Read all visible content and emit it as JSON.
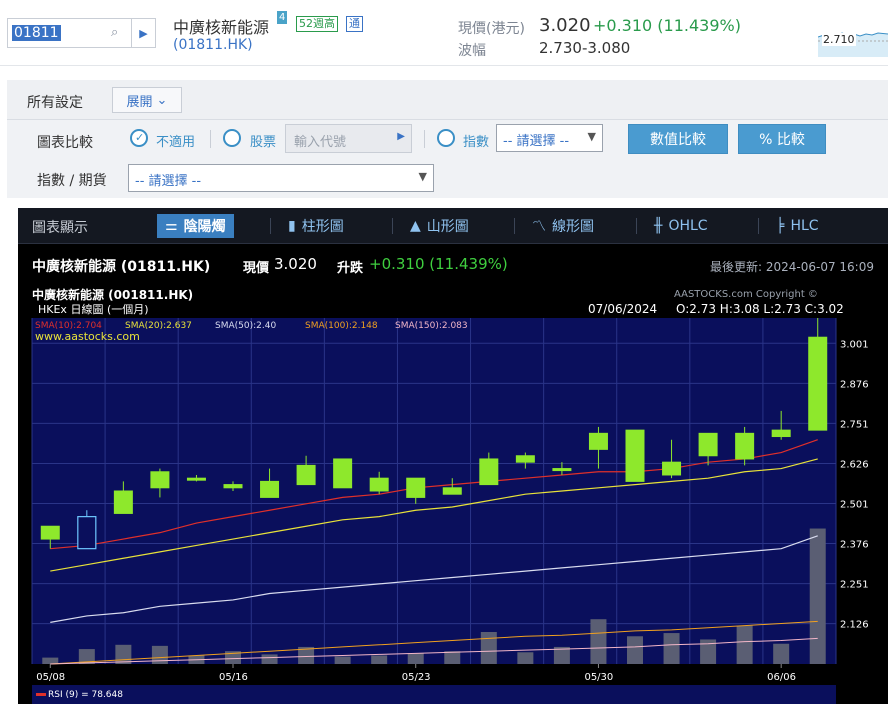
{
  "search": {
    "code": "01811"
  },
  "stock": {
    "name": "中廣核新能源",
    "badge_rank": "4",
    "badge_52w": "52週高",
    "badge_connect": "通",
    "code": "(01811.HK)",
    "price_label": "現價(港元)",
    "price": "3.020",
    "change": "+0.310 (11.439%)",
    "range_label": "波幅",
    "range": "2.730-3.080",
    "mini_label": "2.710"
  },
  "settings": {
    "title": "所有設定",
    "expand": "展開",
    "compare_label": "圖表比較",
    "opt_none": "不適用",
    "opt_stock": "股票",
    "code_placeholder": "輸入代號",
    "opt_index": "指數",
    "select_placeholder": "-- 請選擇 --",
    "btn_value": "數值比較",
    "btn_percent": "% 比較",
    "index_label": "指數 / 期貨",
    "index_select": "-- 請選擇 --"
  },
  "chart_tabs": {
    "title": "圖表顯示",
    "candle": "陰陽燭",
    "bar": "柱形圖",
    "mountain": "山形圖",
    "line": "線形圖",
    "ohlc": "OHLC",
    "hlc": "HLC"
  },
  "chart_info": {
    "name": "中廣核新能源 (01811.HK)",
    "price_label": "現價",
    "price": "3.020",
    "change_label": "升跌",
    "change": "+0.310 (11.439%)",
    "last_update": "最後更新: 2024-06-07 16:09"
  },
  "colors": {
    "up": "#8ee82c",
    "down": "#6ec7ff",
    "plot_bg": "#0a0f5c",
    "sma10": "#e0302a",
    "sma20": "#e8e23a",
    "sma50": "#d9dcef",
    "sma100": "#f0a020",
    "sma150": "#f2b6c8"
  },
  "chart_data": {
    "type": "candlestick",
    "title": "中廣核新能源 (001811.HK)",
    "subtitle": "HKEx 日線圖 (一個月)",
    "copyright": "AASTOCKS.com Copyright ©",
    "watermark": "www.aastocks.com",
    "date_readout": "07/06/2024",
    "ohlc_readout": "O:2.73  H:3.08  L:2.73  C:3.02",
    "sma_labels": {
      "sma10": "SMA(10):2.704",
      "sma20": "SMA(20):2.637",
      "sma50": "SMA(50):2.40",
      "sma100": "SMA(100):2.148",
      "sma150": "SMA(150):2.083"
    },
    "rsi_label": "RSI (9)  = 78.648",
    "y_ticks": [
      "3.001",
      "2.876",
      "2.751",
      "2.626",
      "2.501",
      "2.376",
      "2.251",
      "2.126"
    ],
    "ylim": [
      2.0,
      3.08
    ],
    "x_labels": [
      {
        "label": "05/08",
        "index": 0
      },
      {
        "label": "05/16",
        "index": 5
      },
      {
        "label": "05/23",
        "index": 10
      },
      {
        "label": "05/30",
        "index": 15
      },
      {
        "label": "06/06",
        "index": 20
      }
    ],
    "candles": [
      {
        "o": 2.39,
        "h": 2.42,
        "l": 2.36,
        "c": 2.43
      },
      {
        "o": 2.46,
        "h": 2.48,
        "l": 2.39,
        "c": 2.36
      },
      {
        "o": 2.47,
        "h": 2.57,
        "l": 2.47,
        "c": 2.54
      },
      {
        "o": 2.55,
        "h": 2.61,
        "l": 2.52,
        "c": 2.6
      },
      {
        "o": 2.58,
        "h": 2.59,
        "l": 2.57,
        "c": 2.58
      },
      {
        "o": 2.55,
        "h": 2.57,
        "l": 2.54,
        "c": 2.56
      },
      {
        "o": 2.52,
        "h": 2.61,
        "l": 2.52,
        "c": 2.57
      },
      {
        "o": 2.56,
        "h": 2.65,
        "l": 2.56,
        "c": 2.62
      },
      {
        "o": 2.55,
        "h": 2.64,
        "l": 2.55,
        "c": 2.64
      },
      {
        "o": 2.54,
        "h": 2.6,
        "l": 2.53,
        "c": 2.58
      },
      {
        "o": 2.52,
        "h": 2.58,
        "l": 2.5,
        "c": 2.58
      },
      {
        "o": 2.53,
        "h": 2.58,
        "l": 2.53,
        "c": 2.55
      },
      {
        "o": 2.56,
        "h": 2.66,
        "l": 2.56,
        "c": 2.64
      },
      {
        "o": 2.63,
        "h": 2.66,
        "l": 2.61,
        "c": 2.65
      },
      {
        "o": 2.61,
        "h": 2.63,
        "l": 2.59,
        "c": 2.61
      },
      {
        "o": 2.67,
        "h": 2.74,
        "l": 2.61,
        "c": 2.72
      },
      {
        "o": 2.57,
        "h": 2.73,
        "l": 2.57,
        "c": 2.73
      },
      {
        "o": 2.59,
        "h": 2.7,
        "l": 2.58,
        "c": 2.63
      },
      {
        "o": 2.65,
        "h": 2.72,
        "l": 2.62,
        "c": 2.72
      },
      {
        "o": 2.64,
        "h": 2.74,
        "l": 2.62,
        "c": 2.72
      },
      {
        "o": 2.71,
        "h": 2.79,
        "l": 2.7,
        "c": 2.73
      },
      {
        "o": 2.73,
        "h": 3.08,
        "l": 2.73,
        "c": 3.02
      }
    ],
    "volume": [
      6,
      14,
      18,
      17,
      8,
      12,
      9,
      16,
      7,
      8,
      10,
      12,
      30,
      11,
      16,
      42,
      26,
      29,
      23,
      36,
      19,
      127
    ],
    "volume_max": 150,
    "series": [
      {
        "name": "SMA(10)",
        "values": [
          2.36,
          2.37,
          2.39,
          2.41,
          2.44,
          2.46,
          2.48,
          2.5,
          2.52,
          2.53,
          2.55,
          2.56,
          2.57,
          2.58,
          2.59,
          2.6,
          2.6,
          2.61,
          2.63,
          2.64,
          2.66,
          2.7
        ]
      },
      {
        "name": "SMA(20)",
        "values": [
          2.29,
          2.31,
          2.33,
          2.35,
          2.37,
          2.39,
          2.41,
          2.43,
          2.45,
          2.46,
          2.48,
          2.49,
          2.51,
          2.53,
          2.54,
          2.55,
          2.56,
          2.57,
          2.58,
          2.6,
          2.61,
          2.64
        ]
      },
      {
        "name": "SMA(50)",
        "values": [
          2.13,
          2.15,
          2.16,
          2.18,
          2.19,
          2.2,
          2.22,
          2.23,
          2.24,
          2.25,
          2.26,
          2.27,
          2.28,
          2.29,
          2.3,
          2.31,
          2.32,
          2.33,
          2.34,
          2.35,
          2.36,
          2.4
        ]
      }
    ],
    "volume_lines": [
      {
        "name": "SMA(100)",
        "values": [
          0,
          2,
          4,
          6,
          8,
          10,
          12,
          14,
          16,
          18,
          20,
          22,
          24,
          26,
          27,
          29,
          31,
          32,
          34,
          36,
          38,
          40
        ]
      },
      {
        "name": "SMA(150)",
        "values": [
          0,
          1,
          2,
          3,
          4,
          5,
          6,
          7,
          8,
          9,
          10,
          11,
          12,
          13,
          14,
          15,
          16,
          18,
          19,
          21,
          22,
          24
        ]
      }
    ]
  }
}
